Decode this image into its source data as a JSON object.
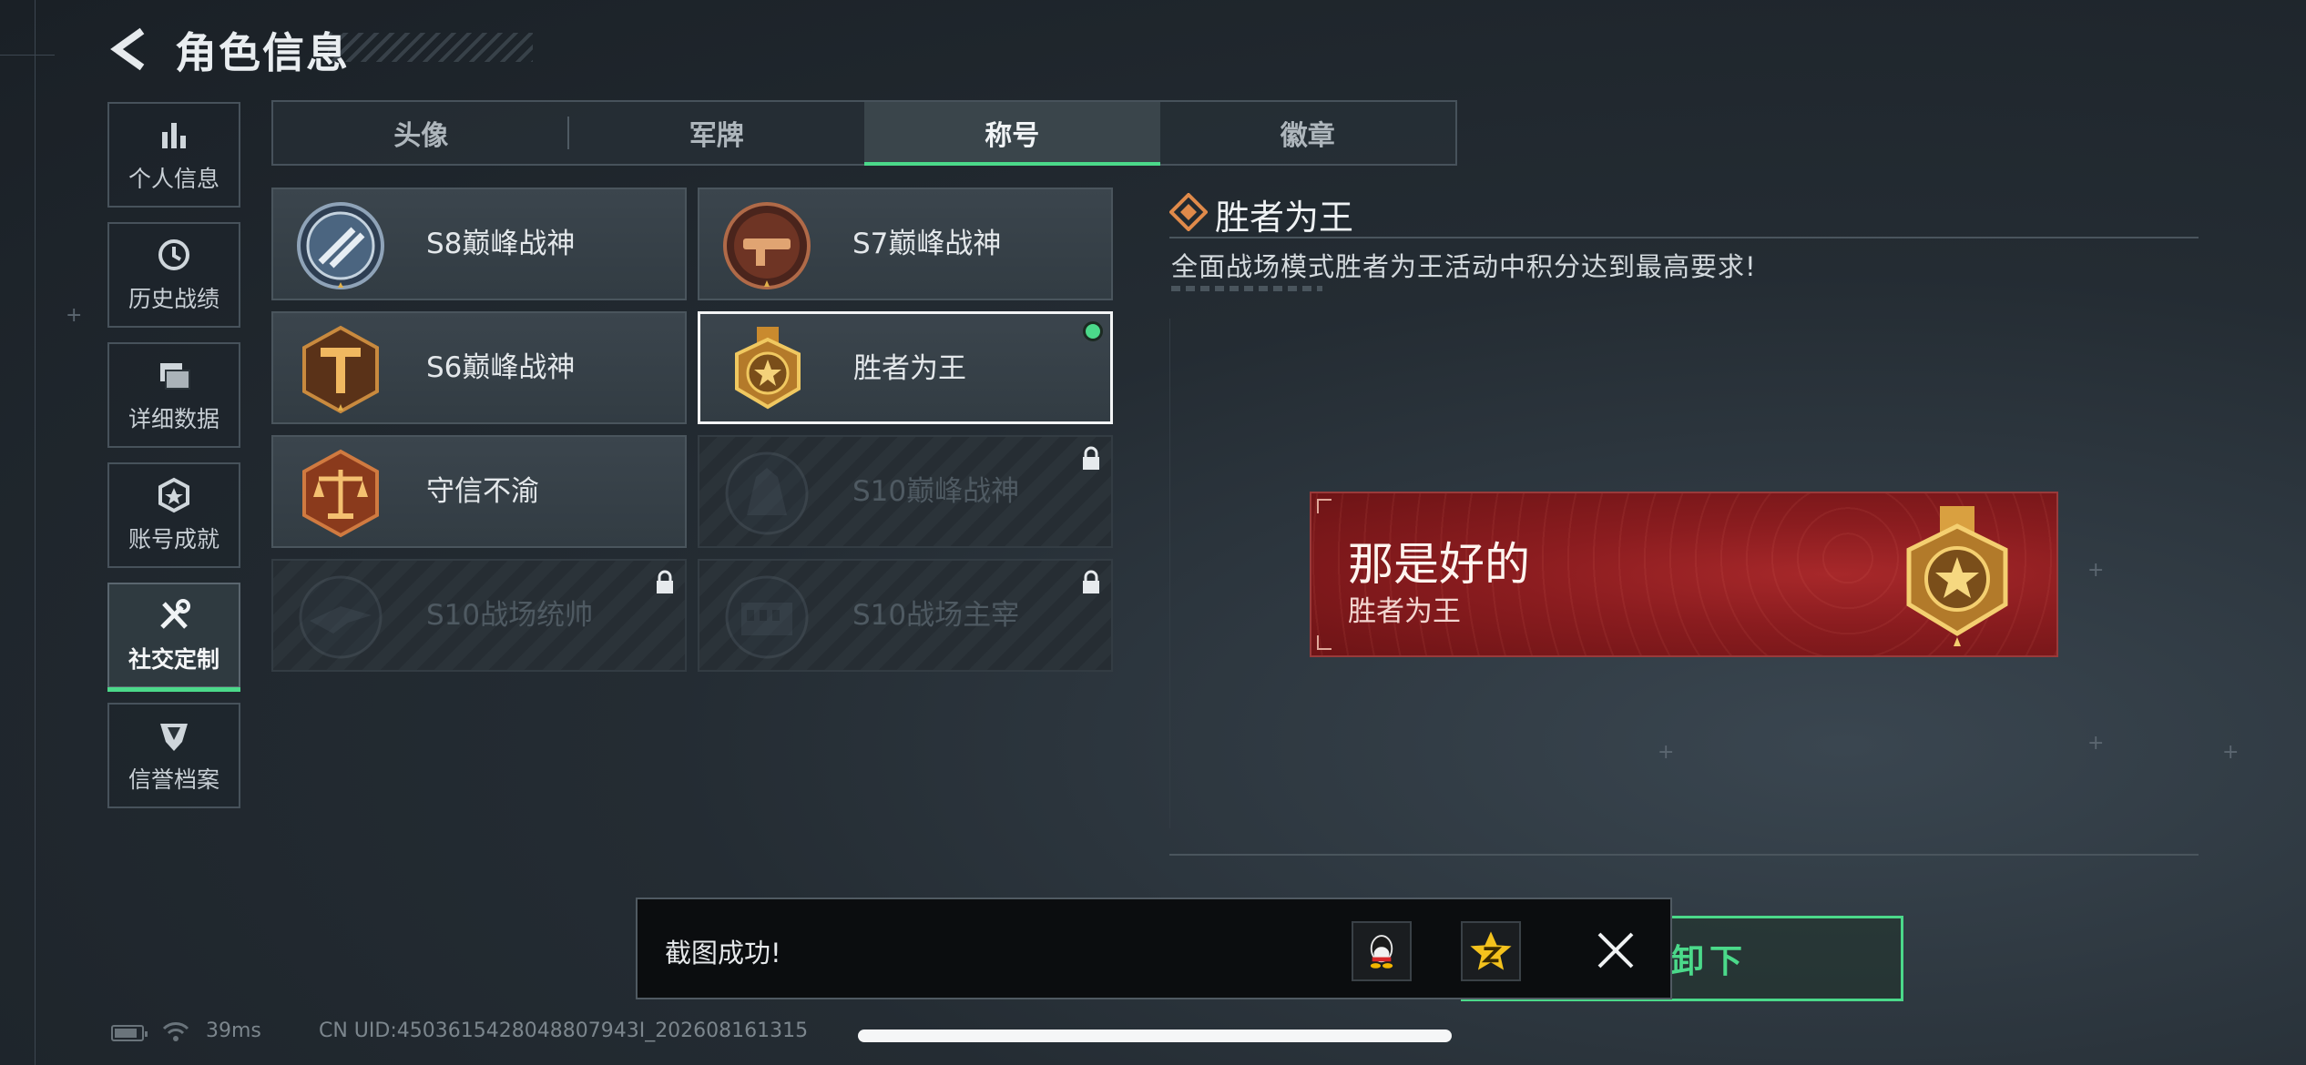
{
  "header": {
    "title": "角色信息"
  },
  "sidebar": {
    "items": [
      {
        "label": "个人信息",
        "icon": "bar-chart-icon"
      },
      {
        "label": "历史战绩",
        "icon": "clock-history-icon"
      },
      {
        "label": "详细数据",
        "icon": "folder-icon"
      },
      {
        "label": "账号成就",
        "icon": "achievement-icon"
      },
      {
        "label": "社交定制",
        "icon": "tools-icon",
        "active": true
      },
      {
        "label": "信誉档案",
        "icon": "shield-icon"
      }
    ]
  },
  "tabs": [
    {
      "label": "头像"
    },
    {
      "label": "军牌"
    },
    {
      "label": "称号",
      "active": true
    },
    {
      "label": "徽章"
    }
  ],
  "titles": [
    {
      "name": "S8巅峰战神",
      "locked": false
    },
    {
      "name": "S7巅峰战神",
      "locked": false
    },
    {
      "name": "S6巅峰战神",
      "locked": false
    },
    {
      "name": "胜者为王",
      "locked": false,
      "selected": true,
      "equipped": true
    },
    {
      "name": "守信不渝",
      "locked": false
    },
    {
      "name": "S10巅峰战神",
      "locked": true
    },
    {
      "name": "S10战场统帅",
      "locked": true
    },
    {
      "name": "S10战场主宰",
      "locked": true
    }
  ],
  "detail": {
    "title": "胜者为王",
    "description": "全面战场模式胜者为王活动中积分达到最高要求!"
  },
  "preview": {
    "main_text": "那是好的",
    "sub_text": "胜者为王"
  },
  "equip_button": {
    "label": "卸下"
  },
  "toast": {
    "message": "截图成功!",
    "share_icons": [
      "qq-icon",
      "qzone-icon"
    ]
  },
  "status": {
    "ping": "39ms",
    "uid": "CN UID:4503615428048807943I_202608161315"
  },
  "colors": {
    "accent_green": "#4bd98a",
    "banner_red": "#a7282a",
    "background": "#242c33"
  }
}
